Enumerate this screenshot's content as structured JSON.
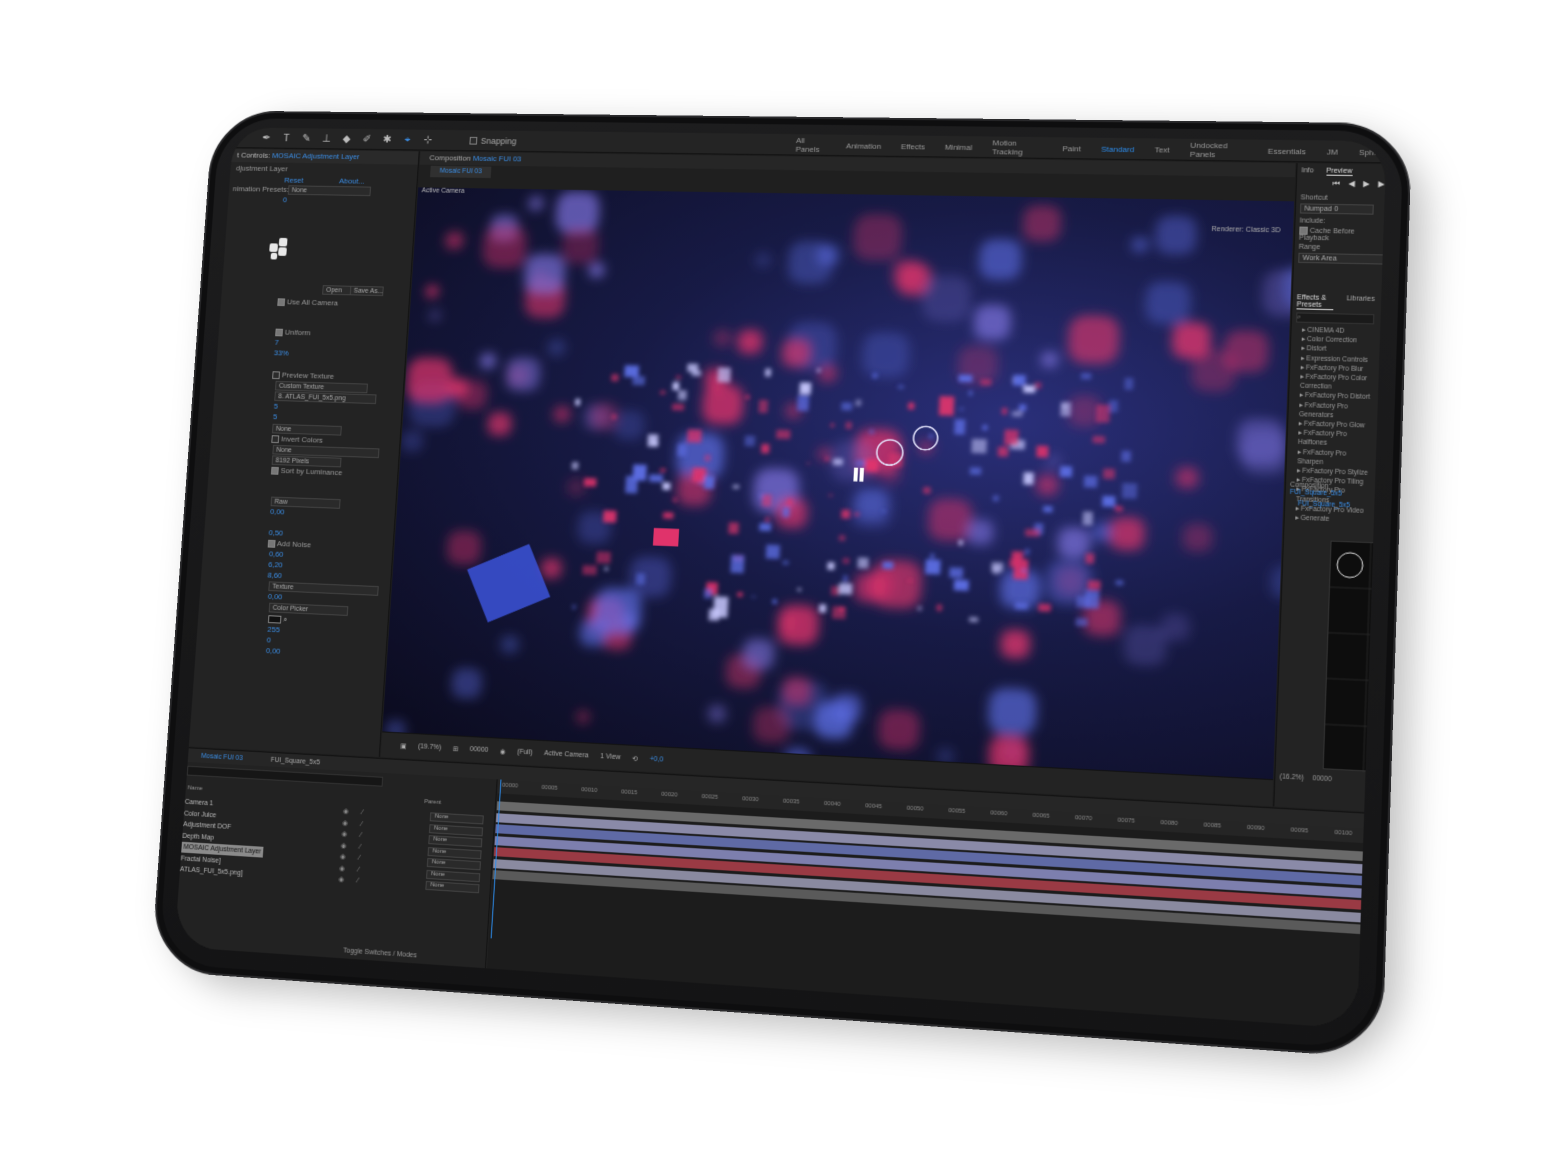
{
  "toolbar": {
    "snapping_label": "Snapping",
    "workspaces": [
      "All Panels",
      "Animation",
      "Effects",
      "Minimal",
      "Motion Tracking",
      "Paint",
      "Standard",
      "Text",
      "Undocked Panels",
      "Essentials",
      "JM",
      "Sphere"
    ],
    "active_workspace": "Standard"
  },
  "effect_controls": {
    "panel_title_prefix": "t Controls",
    "layer_name": "MOSAIC Adjustment Layer",
    "sub_title": "djustment Layer",
    "reset_label": "Reset",
    "about_label": "About...",
    "presets_label": "nimation Presets:",
    "presets_value": "None",
    "zero_value": "0",
    "open_label": "Open",
    "save_as_label": "Save As...",
    "use_all_camera": "Use All Camera",
    "uniform": "Uniform",
    "v7": "7",
    "v33": "33%",
    "preview_texture": "Preview Texture",
    "custom_texture": "Custom Texture",
    "atlas_file": "8. ATLAS_FUI_5x5.png",
    "v5a": "5",
    "v5b": "5",
    "none1": "None",
    "invert_colors": "Invert Colors",
    "none2": "None",
    "pixels": "8192 Pixels",
    "sort_by_luminance": "Sort by Luminance",
    "raw": "Raw",
    "v000a": "0,00",
    "v050": "0,50",
    "add_noise": "Add Noise",
    "v060": "0,60",
    "v620": "6,20",
    "v860": "8,60",
    "texture": "Texture",
    "v000b": "0,00",
    "color_picker": "Color Picker",
    "v255": "255",
    "v0": "0",
    "v000c": "0,00"
  },
  "composition": {
    "header_label": "Composition",
    "comp_name": "Mosaic FUI 03",
    "tab_label": "Mosaic FUI 03",
    "active_camera": "Active Camera",
    "renderer_label": "Renderer:",
    "renderer_value": "Classic 3D",
    "footer": {
      "zoom": "(19.7%)",
      "timecode": "00000",
      "resolution": "(Full)",
      "camera": "Active Camera",
      "views": "1 View",
      "exposure": "+0,0"
    }
  },
  "right_panel": {
    "tabs_top": [
      "Info",
      "Preview"
    ],
    "shortcut_label": "Shortcut",
    "shortcut_value": "Numpad 0",
    "include_label": "Include:",
    "cache_label": "Cache Before Playback",
    "range_label": "Range",
    "range_value": "Work Area",
    "tabs_effects": [
      "Effects & Presets",
      "Libraries"
    ],
    "effects": [
      "CINEMA 4D",
      "Color Correction",
      "Distort",
      "Expression Controls",
      "FxFactory Pro Blur",
      "FxFactory Pro Color Correction",
      "FxFactory Pro Distort",
      "FxFactory Pro Generators",
      "FxFactory Pro Glow",
      "FxFactory Pro Halftones",
      "FxFactory Pro Sharpen",
      "FxFactory Pro Stylize",
      "FxFactory Pro Tiling",
      "FxFactory Pro Transitions",
      "FxFactory Pro Video",
      "Generate"
    ],
    "mini_comp_label": "Composition",
    "mini_comp_name": "FUI_Square_5x5",
    "mini_tab": "FUI_Square_5x5",
    "mini_zoom": "(16.2%)",
    "mini_time": "00000"
  },
  "timeline": {
    "tabs": [
      "Mosaic FUI 03",
      "FUI_Square_5x5"
    ],
    "source_name_col": "Name",
    "parent_col": "Parent",
    "layers": [
      {
        "name": "Camera 1",
        "parent": "None"
      },
      {
        "name": "Color Juice",
        "parent": "None"
      },
      {
        "name": "Adjustment DOF",
        "parent": "None"
      },
      {
        "name": "Depth Map",
        "parent": "None"
      },
      {
        "name": "MOSAIC Adjustment Layer",
        "parent": "None"
      },
      {
        "name": "Fractal Noise]",
        "parent": "None"
      },
      {
        "name": "ATLAS_FUI_5x5.png]",
        "parent": "None"
      }
    ],
    "ruler_marks": [
      "00000",
      "00005",
      "00010",
      "00015",
      "00020",
      "00025",
      "00030",
      "00035",
      "00040",
      "00045",
      "00050",
      "00055",
      "00060",
      "00065",
      "00070",
      "00075",
      "00080",
      "00085",
      "00090",
      "00095",
      "00100",
      "00105",
      "00110"
    ],
    "footer_label": "Toggle Switches / Modes",
    "bar_colors": [
      "#6a6a6a",
      "#8a8aa8",
      "#5f6aa5",
      "#7d7fae",
      "#9a3a44",
      "#8a8aa0",
      "#5a5a5a"
    ]
  },
  "colors": {
    "accent": "#3b8ee6",
    "viewer_pink": "#e0336b",
    "viewer_blue": "#5a6be0"
  }
}
